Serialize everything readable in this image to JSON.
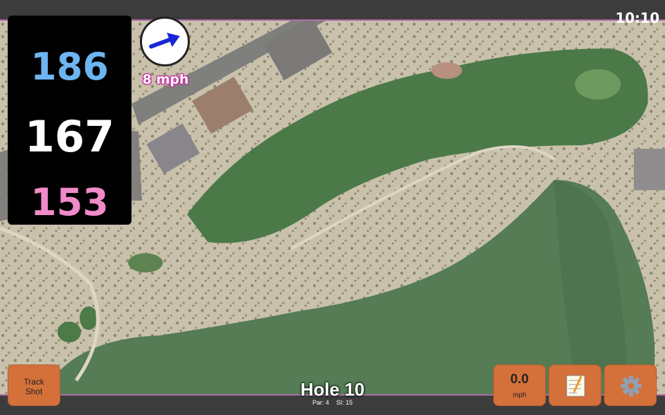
{
  "status_bar": {
    "time": "10:10"
  },
  "distances": {
    "back": "186",
    "center": "167",
    "front": "153"
  },
  "wind": {
    "speed_label": "8 mph",
    "direction_icon": "wind-arrow-icon"
  },
  "hole": {
    "title": "Hole 10",
    "par_label": "Par: 4",
    "si_label": "SI: 15"
  },
  "buttons": {
    "track_shot_line1": "Track",
    "track_shot_line2": "Shot",
    "speed_value": "0.0",
    "speed_unit": "mph",
    "notes_icon": "notepad-icon",
    "settings_icon": "gear-icon"
  },
  "colors": {
    "back_distance": "#6db4f1",
    "center_distance": "#ffffff",
    "front_distance": "#f08ac8",
    "button": "#d4703a",
    "accent": "#b06aa8"
  }
}
